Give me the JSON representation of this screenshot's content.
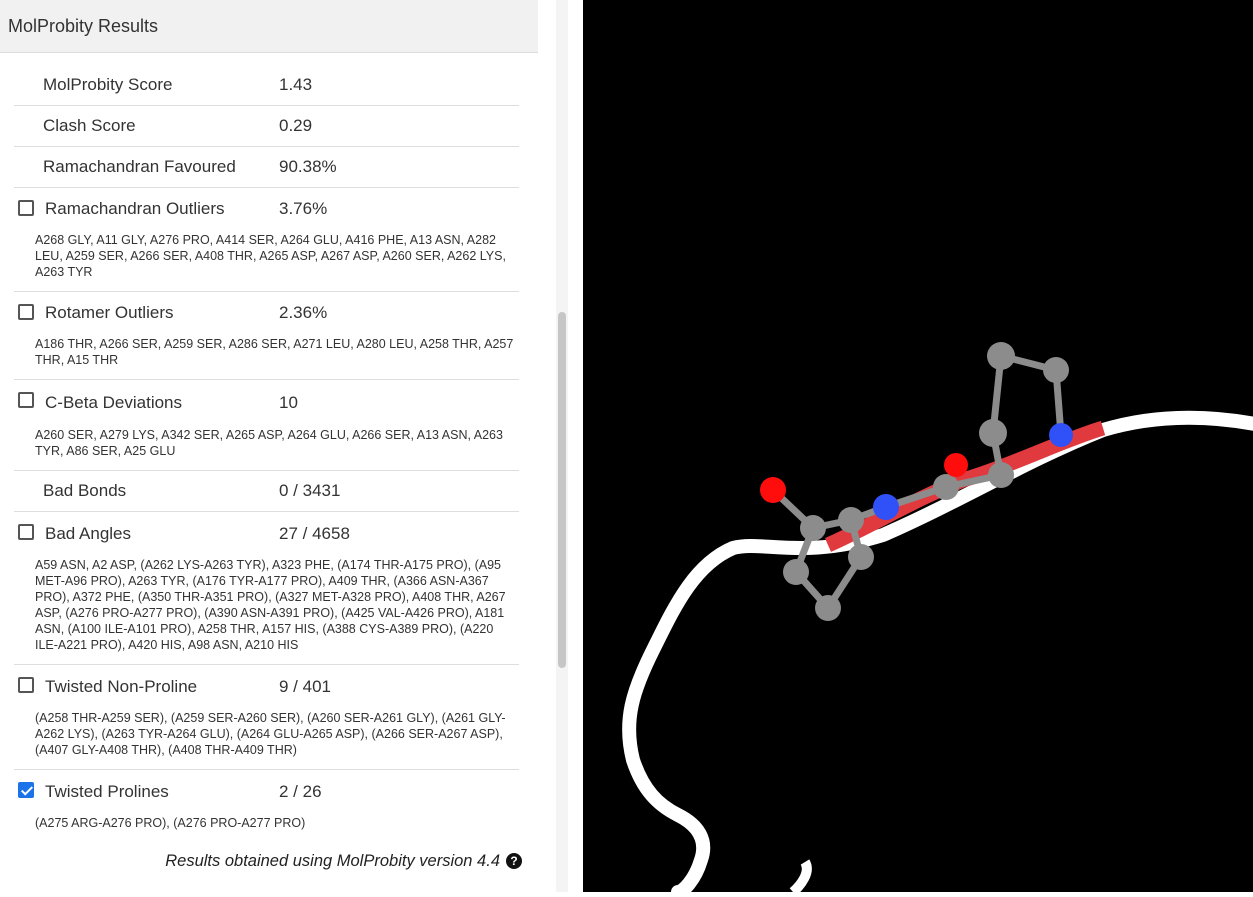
{
  "panel": {
    "title": "MolProbity Results"
  },
  "rows": [
    {
      "label": "MolProbity Score",
      "value": "1.43",
      "checkbox": null,
      "detail": ""
    },
    {
      "label": "Clash Score",
      "value": "0.29",
      "checkbox": null,
      "detail": ""
    },
    {
      "label": "Ramachandran Favoured",
      "value": "90.38%",
      "checkbox": null,
      "detail": ""
    },
    {
      "label": "Ramachandran Outliers",
      "value": "3.76%",
      "checkbox": false,
      "detail": "A268 GLY, A11 GLY, A276 PRO, A414 SER, A264 GLU, A416 PHE, A13 ASN, A282 LEU, A259 SER, A266 SER, A408 THR, A265 ASP, A267 ASP, A260 SER, A262 LYS, A263 TYR"
    },
    {
      "label": "Rotamer Outliers",
      "value": "2.36%",
      "checkbox": false,
      "detail": "A186 THR, A266 SER, A259 SER, A286 SER, A271 LEU, A280 LEU, A258 THR, A257 THR, A15 THR"
    },
    {
      "label": "C-Beta Deviations",
      "value": "10",
      "checkbox": false,
      "detail": "A260 SER, A279 LYS, A342 SER, A265 ASP, A264 GLU, A266 SER, A13 ASN, A263 TYR, A86 SER, A25 GLU"
    },
    {
      "label": "Bad Bonds",
      "value": "0 / 3431",
      "checkbox": null,
      "detail": ""
    },
    {
      "label": "Bad Angles",
      "value": "27 / 4658",
      "checkbox": false,
      "detail": "A59 ASN, A2 ASP, (A262 LYS-A263 TYR), A323 PHE, (A174 THR-A175 PRO), (A95 MET-A96 PRO), A263 TYR, (A176 TYR-A177 PRO), A409 THR, (A366 ASN-A367 PRO), A372 PHE, (A350 THR-A351 PRO), (A327 MET-A328 PRO), A408 THR, A267 ASP, (A276 PRO-A277 PRO), (A390 ASN-A391 PRO), (A425 VAL-A426 PRO), A181 ASN, (A100 ILE-A101 PRO), A258 THR, A157 HIS, (A388 CYS-A389 PRO), (A220 ILE-A221 PRO), A420 HIS, A98 ASN, A210 HIS"
    },
    {
      "label": "Twisted Non-Proline",
      "value": "9 / 401",
      "checkbox": false,
      "detail": "(A258 THR-A259 SER), (A259 SER-A260 SER), (A260 SER-A261 GLY), (A261 GLY-A262 LYS), (A263 TYR-A264 GLU), (A264 GLU-A265 ASP), (A266 SER-A267 ASP), (A407 GLY-A408 THR), (A408 THR-A409 THR)"
    },
    {
      "label": "Twisted Prolines",
      "value": "2 / 26",
      "checkbox": true,
      "detail": "(A275 ARG-A276 PRO), (A276 PRO-A277 PRO)"
    }
  ],
  "footer": {
    "text": "Results obtained using MolProbity version 4.4",
    "help_icon": "question-circle-icon"
  },
  "viewer": {
    "background": "#000000",
    "ribbon_color": "#ffffff",
    "highlight_color": "#e0393e",
    "atom_colors": {
      "carbon": "#8c8c8c",
      "nitrogen": "#3050f8",
      "oxygen": "#ff0d0d"
    }
  }
}
